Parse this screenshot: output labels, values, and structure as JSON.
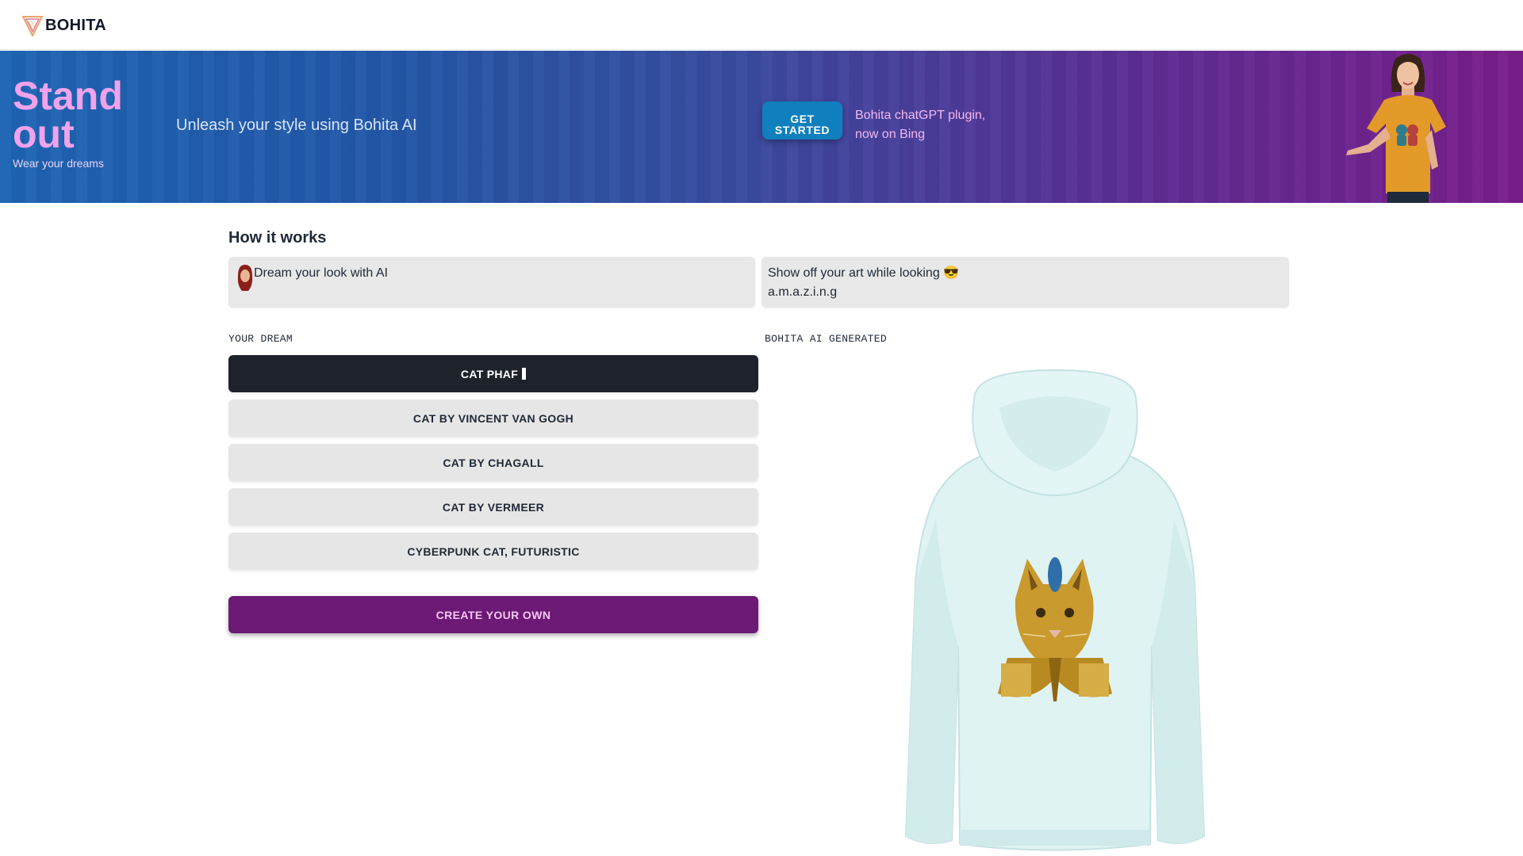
{
  "brand": {
    "name": "BOHITA",
    "logo_icon": "bohita-v-logo-icon"
  },
  "hero": {
    "title_line1": "Stand",
    "title_line2": "out",
    "subtitle": "Wear your dreams",
    "tagline": "Unleash your style using Bohita AI",
    "cta_label_line1": "GET",
    "cta_label_line2": "STARTED",
    "plugin_line1": "Bohita chatGPT plugin,",
    "plugin_line2": "now on Bing",
    "model_image": "woman-in-orange-tshirt-pointing"
  },
  "how_it_works": {
    "title": "How it works",
    "steps": [
      {
        "text": "Dream your look with AI",
        "icon": "woman-avatar-icon"
      },
      {
        "text_line1": "Show off your art while looking 😎",
        "text_line2": "a.m.a.z.i.n.g"
      }
    ]
  },
  "dream": {
    "label": "YOUR DREAM",
    "typing_value": "CAT PHAF",
    "prompts": [
      "CAT BY VINCENT VAN GOGH",
      "CAT BY CHAGALL",
      "CAT BY VERMEER",
      "CYBERPUNK CAT, FUTURISTIC"
    ],
    "create_label": "CREATE YOUR OWN"
  },
  "generated": {
    "label": "BOHITA AI GENERATED",
    "image": "light-blue-hoodie-with-golden-pharaoh-cat-print"
  },
  "colors": {
    "hero_gradient_start": "#1e65b4",
    "hero_gradient_end": "#7a1d8b",
    "hero_title": "#f0a3ec",
    "cta_blue": "#0f7fbe",
    "create_purple": "#6c1a75",
    "active_prompt": "#1e232b",
    "hoodie": "#dff3f3",
    "gold": "#c99a2e"
  }
}
